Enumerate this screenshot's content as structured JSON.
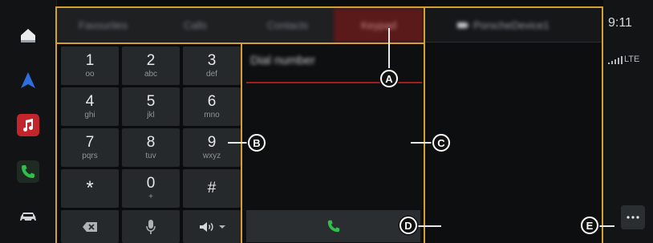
{
  "tabs": [
    {
      "label": "Favourites"
    },
    {
      "label": "Calls"
    },
    {
      "label": "Contacts"
    },
    {
      "label": "Keypad"
    }
  ],
  "keypad": {
    "keys": [
      {
        "digit": "1",
        "sub": "oo"
      },
      {
        "digit": "2",
        "sub": "abc"
      },
      {
        "digit": "3",
        "sub": "def"
      },
      {
        "digit": "4",
        "sub": "ghi"
      },
      {
        "digit": "5",
        "sub": "jkl"
      },
      {
        "digit": "6",
        "sub": "mno"
      },
      {
        "digit": "7",
        "sub": "pqrs"
      },
      {
        "digit": "8",
        "sub": "tuv"
      },
      {
        "digit": "9",
        "sub": "wxyz"
      },
      {
        "digit": "*",
        "sub": ""
      },
      {
        "digit": "0",
        "sub": "+"
      },
      {
        "digit": "#",
        "sub": ""
      }
    ]
  },
  "dial": {
    "number_placeholder": "Dial number"
  },
  "contact_panel": {
    "device_name": "PorscheDevice1"
  },
  "status": {
    "time": "9:11",
    "network": "LTE"
  },
  "callouts": [
    "A",
    "B",
    "C",
    "D",
    "E"
  ],
  "colors": {
    "accent_red": "#a21d1d",
    "call_green": "#2fbf4a",
    "annotation_gold": "#d4a02f"
  }
}
